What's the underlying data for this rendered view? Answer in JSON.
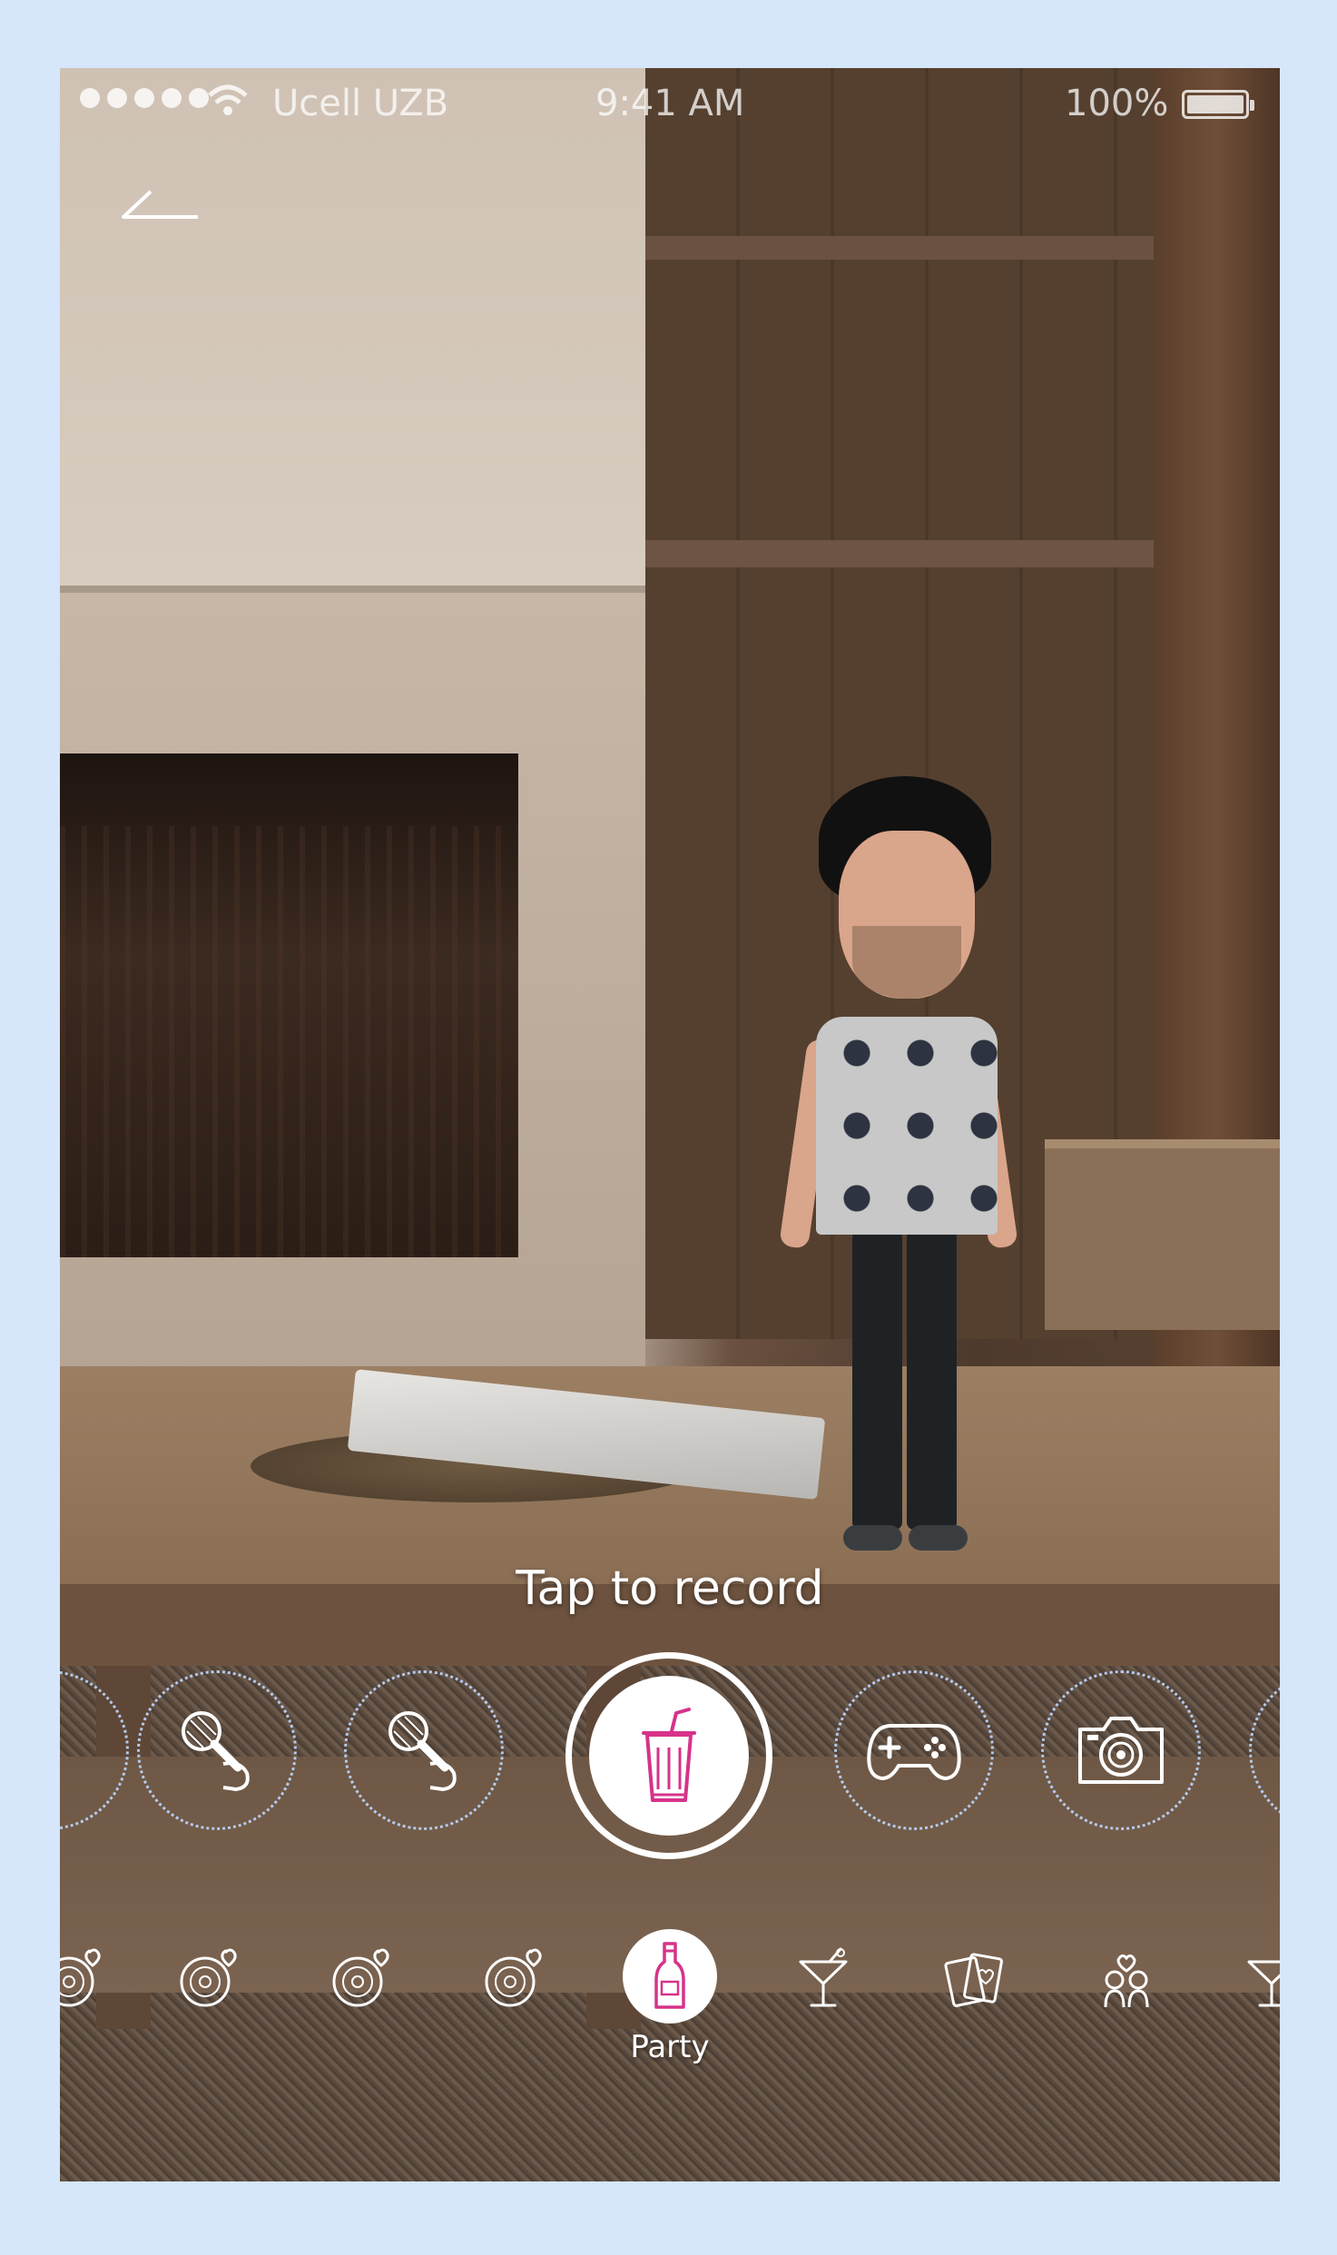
{
  "status_bar": {
    "carrier": "Ucell UZB",
    "time": "9:41 AM",
    "battery_percent": "100%"
  },
  "record": {
    "label": "Tap to record",
    "icon": "drink-cup-icon"
  },
  "actions": [
    {
      "icon": "karaoke-microphone-icon"
    },
    {
      "icon": "karaoke-microphone-icon"
    },
    {
      "icon": "gamepad-icon"
    },
    {
      "icon": "camera-icon"
    }
  ],
  "categories": {
    "active_label": "Party",
    "active_icon": "champagne-bottle-icon",
    "items": [
      "vinyl-heart-icon",
      "vinyl-heart-icon",
      "vinyl-heart-icon",
      "vinyl-heart-icon",
      "cocktail-glass-icon",
      "playing-cards-icon",
      "couple-heart-icon",
      "cocktail-glass-icon"
    ]
  },
  "colors": {
    "accent": "#d6338a",
    "background": "#d6e6fb",
    "dotted_ring": "#bed7ff"
  }
}
